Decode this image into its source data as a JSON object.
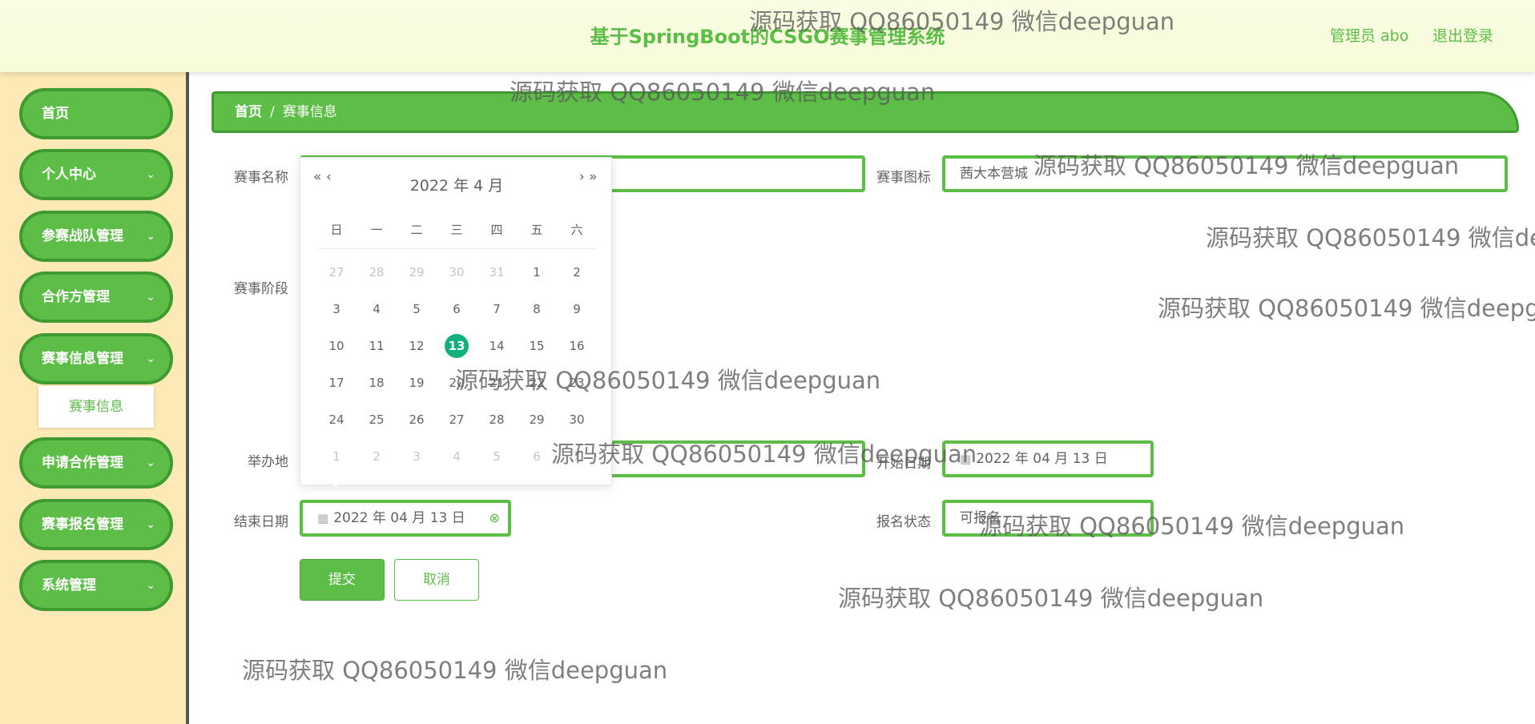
{
  "header": {
    "title": "基于SpringBoot的CSGO赛事管理系统",
    "user": "管理员 abo",
    "logout": "退出登录"
  },
  "sidebar": {
    "items": [
      {
        "label": "首页"
      },
      {
        "label": "个人中心"
      },
      {
        "label": "参赛战队管理"
      },
      {
        "label": "合作方管理"
      },
      {
        "label": "赛事信息管理"
      },
      {
        "label": "申请合作管理"
      },
      {
        "label": "赛事报名管理"
      },
      {
        "label": "系统管理"
      }
    ],
    "sub_item": "赛事信息",
    "chevron": "chevron-down-icon"
  },
  "breadcrumb": {
    "home": "首页",
    "separator": "/",
    "current": "赛事信息"
  },
  "form": {
    "name_label": "赛事名称",
    "name_value": "",
    "icon_label": "赛事图标",
    "icon_value": "茜大本营城",
    "stage_label": "赛事阶段",
    "venue_label": "举办地",
    "venue_value": "",
    "start_label": "开始日期",
    "start_value": "2022 年 04 月 13 日",
    "end_label": "结束日期",
    "end_value": "2022 年 04 月 13 日",
    "status_label": "报名状态",
    "status_value": "可报名",
    "submit": "提交",
    "cancel": "取消"
  },
  "datepicker": {
    "prev_year": "«",
    "prev_month": "‹",
    "next_month": "›",
    "next_year": "»",
    "year_month": "2022 年  4 月",
    "weekdays": [
      "日",
      "一",
      "二",
      "三",
      "四",
      "五",
      "六"
    ],
    "days": [
      {
        "d": "27",
        "other": true
      },
      {
        "d": "28",
        "other": true
      },
      {
        "d": "29",
        "other": true
      },
      {
        "d": "30",
        "other": true
      },
      {
        "d": "31",
        "other": true
      },
      {
        "d": "1"
      },
      {
        "d": "2"
      },
      {
        "d": "3"
      },
      {
        "d": "4"
      },
      {
        "d": "5"
      },
      {
        "d": "6"
      },
      {
        "d": "7"
      },
      {
        "d": "8"
      },
      {
        "d": "9"
      },
      {
        "d": "10"
      },
      {
        "d": "11"
      },
      {
        "d": "12"
      },
      {
        "d": "13",
        "today": true
      },
      {
        "d": "14"
      },
      {
        "d": "15"
      },
      {
        "d": "16"
      },
      {
        "d": "17"
      },
      {
        "d": "18"
      },
      {
        "d": "19"
      },
      {
        "d": "20"
      },
      {
        "d": "21"
      },
      {
        "d": "22"
      },
      {
        "d": "23"
      },
      {
        "d": "24"
      },
      {
        "d": "25"
      },
      {
        "d": "26"
      },
      {
        "d": "27"
      },
      {
        "d": "28"
      },
      {
        "d": "29"
      },
      {
        "d": "30"
      },
      {
        "d": "1",
        "other": true
      },
      {
        "d": "2",
        "other": true
      },
      {
        "d": "3",
        "other": true
      },
      {
        "d": "4",
        "other": true
      },
      {
        "d": "5",
        "other": true
      },
      {
        "d": "6",
        "other": true
      },
      {
        "d": "7",
        "other": true
      }
    ]
  },
  "watermark": "源码获取 QQ86050149 微信deepguan",
  "colors": {
    "accent": "#5cbd47",
    "accent_dark": "#3f9a30",
    "today": "#13b07f",
    "sidebar_bg": "#fde9b6"
  }
}
